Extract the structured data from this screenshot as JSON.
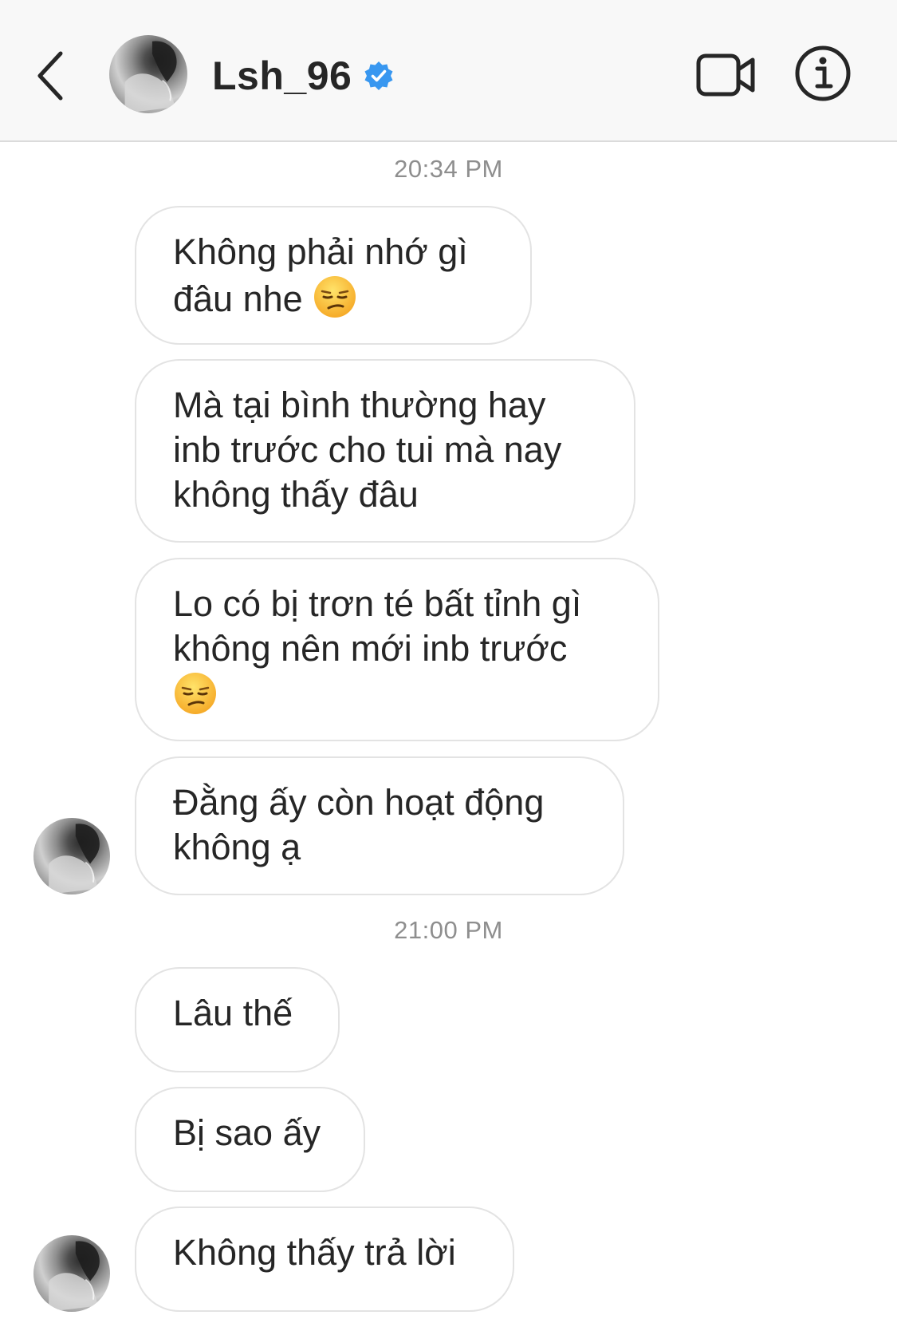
{
  "header": {
    "title": "Lsh_96",
    "verified": true,
    "icons": {
      "back": "chevron-left-icon",
      "verified": "verified-badge-icon",
      "video": "video-call-icon",
      "info": "info-icon"
    },
    "accent_color": "#3897f0"
  },
  "conversation": {
    "timestamps": [
      "20:34 PM",
      "21:00 PM"
    ],
    "messages": [
      {
        "lines": [
          "Không phải nhớ gì",
          "đâu nhe"
        ],
        "emoji": "unamused-face"
      },
      {
        "lines": [
          "Mà tại bình thường hay",
          "inb trước cho tui mà nay",
          "không thấy đâu"
        ]
      },
      {
        "lines": [
          "Lo có bị trơn té bất tỉnh gì",
          "không nên mới inb trước"
        ],
        "emoji": "unamused-face"
      },
      {
        "lines": [
          "Đằng ấy còn hoạt động",
          "không ạ"
        ]
      },
      {
        "lines": [
          "Lâu thế"
        ]
      },
      {
        "lines": [
          "Bị sao ấy"
        ]
      },
      {
        "lines": [
          "Không thấy trả lời"
        ]
      }
    ]
  }
}
